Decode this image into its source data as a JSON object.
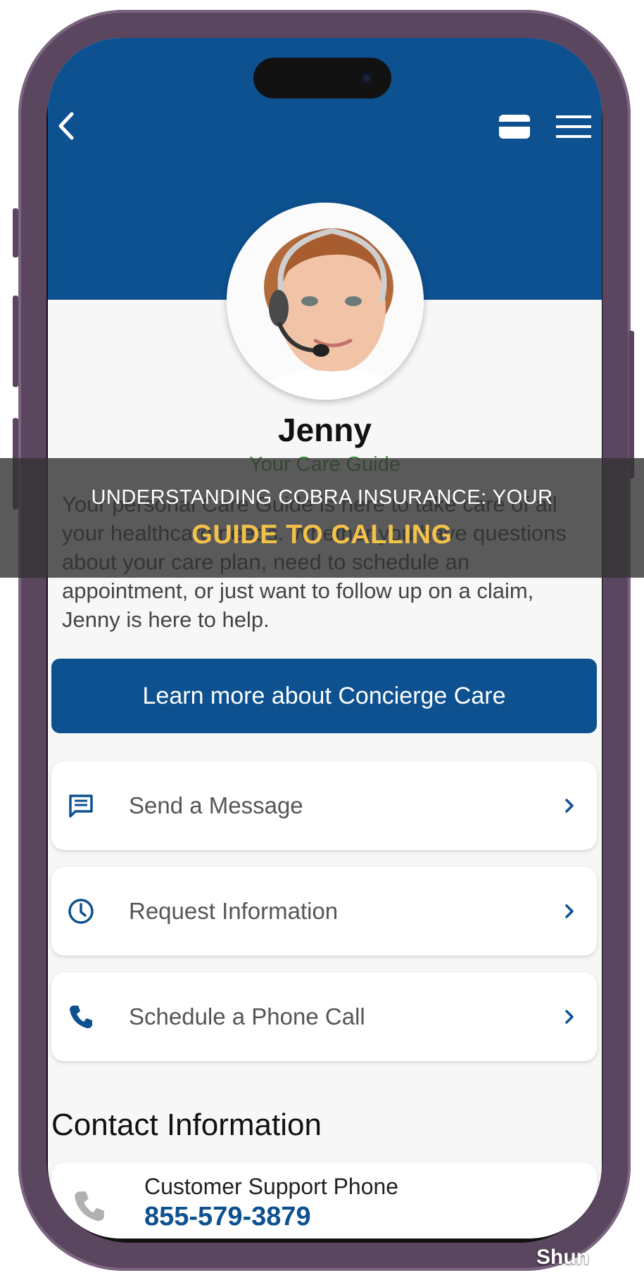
{
  "header": {
    "back_icon": "chevron-left-icon",
    "card_icon": "card-icon",
    "menu_icon": "hamburger-menu-icon"
  },
  "profile": {
    "name": "Jenny",
    "role": "Your Care Guide",
    "description": "Your personal Care Guide is here to take care of all your healthcare needs. Whether you have questions about your care plan, need to schedule an appointment, or just want to follow up on a claim, Jenny is here to help."
  },
  "cta": {
    "label": "Learn more about Concierge Care"
  },
  "actions": [
    {
      "label": "Send a Message",
      "icon": "message-icon"
    },
    {
      "label": "Request Information",
      "icon": "clock-icon"
    },
    {
      "label": "Schedule a Phone Call",
      "icon": "phone-icon"
    }
  ],
  "contact": {
    "title": "Contact Information",
    "support_label": "Customer Support Phone",
    "support_phone": "855-579-3879"
  },
  "overlay": {
    "line1": "UNDERSTANDING COBRA INSURANCE: YOUR",
    "line2": "GUIDE TO CALLING"
  },
  "watermark": "Shun",
  "colors": {
    "brand_blue": "#0d5190",
    "accent_green": "#3e9a3a",
    "overlay_yellow": "#f2c14a"
  }
}
